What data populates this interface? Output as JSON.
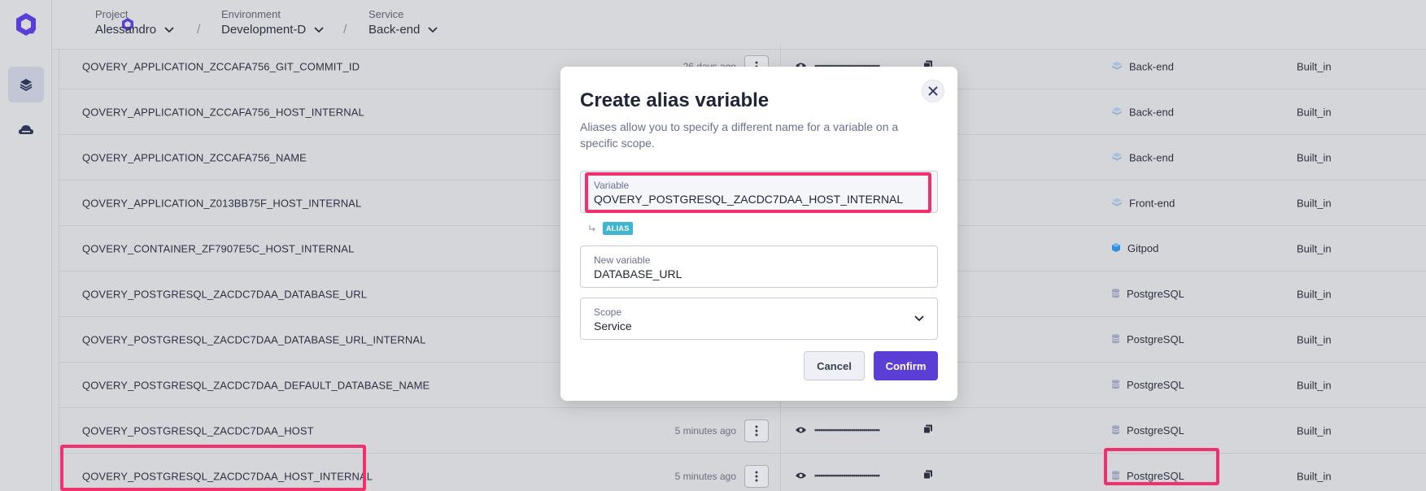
{
  "header": {
    "project": {
      "label": "Project",
      "value": "Alessandro"
    },
    "environment": {
      "label": "Environment",
      "value": "Development-D"
    },
    "service": {
      "label": "Service",
      "value": "Back-end"
    },
    "separator": "/"
  },
  "rows": [
    {
      "name": "QOVERY_APPLICATION_ZCCAFA756_GIT_COMMIT_ID",
      "time": "26 days ago",
      "masked": "••••••••••••••••••••••••••••••••",
      "service": "Back-end",
      "service_icon": "application-icon",
      "scope": "Built_in"
    },
    {
      "name": "QOVERY_APPLICATION_ZCCAFA756_HOST_INTERNAL",
      "time": "",
      "masked": "",
      "service": "Back-end",
      "service_icon": "application-icon",
      "scope": "Built_in"
    },
    {
      "name": "QOVERY_APPLICATION_ZCCAFA756_NAME",
      "time": "",
      "masked": "",
      "service": "Back-end",
      "service_icon": "application-icon",
      "scope": "Built_in"
    },
    {
      "name": "QOVERY_APPLICATION_Z013BB75F_HOST_INTERNAL",
      "time": "",
      "masked": "",
      "service": "Front-end",
      "service_icon": "application-icon",
      "scope": "Built_in"
    },
    {
      "name": "QOVERY_CONTAINER_ZF7907E5C_HOST_INTERNAL",
      "time": "",
      "masked": "",
      "service": "Gitpod",
      "service_icon": "container-icon",
      "scope": "Built_in"
    },
    {
      "name": "QOVERY_POSTGRESQL_ZACDC7DAA_DATABASE_URL",
      "time": "",
      "masked": "",
      "service": "PostgreSQL",
      "service_icon": "database-icon",
      "scope": "Built_in"
    },
    {
      "name": "QOVERY_POSTGRESQL_ZACDC7DAA_DATABASE_URL_INTERNAL",
      "time": "",
      "masked": "",
      "service": "PostgreSQL",
      "service_icon": "database-icon",
      "scope": "Built_in"
    },
    {
      "name": "QOVERY_POSTGRESQL_ZACDC7DAA_DEFAULT_DATABASE_NAME",
      "time": "",
      "masked": "",
      "service": "PostgreSQL",
      "service_icon": "database-icon",
      "scope": "Built_in"
    },
    {
      "name": "QOVERY_POSTGRESQL_ZACDC7DAA_HOST",
      "time": "5 minutes ago",
      "masked": "••••••••••••••••••••••••••••••••",
      "service": "PostgreSQL",
      "service_icon": "database-icon",
      "scope": "Built_in"
    },
    {
      "name": "QOVERY_POSTGRESQL_ZACDC7DAA_HOST_INTERNAL",
      "time": "5 minutes ago",
      "masked": "••••••••••••••••••••••••••••••••",
      "service": "PostgreSQL",
      "service_icon": "database-icon",
      "scope": "Built_in"
    }
  ],
  "modal": {
    "title": "Create alias variable",
    "description": "Aliases allow you to specify a different name for a variable on a specific scope.",
    "variable": {
      "label": "Variable",
      "value": "QOVERY_POSTGRESQL_ZACDC7DAA_HOST_INTERNAL"
    },
    "alias_badge": "ALIAS",
    "new_variable": {
      "label": "New variable",
      "value": "DATABASE_URL"
    },
    "scope": {
      "label": "Scope",
      "value": "Service"
    },
    "cancel_label": "Cancel",
    "confirm_label": "Confirm"
  },
  "colors": {
    "accent": "#5b3ed6",
    "highlight": "#f0316b",
    "alias_badge": "#3fb6d1"
  }
}
